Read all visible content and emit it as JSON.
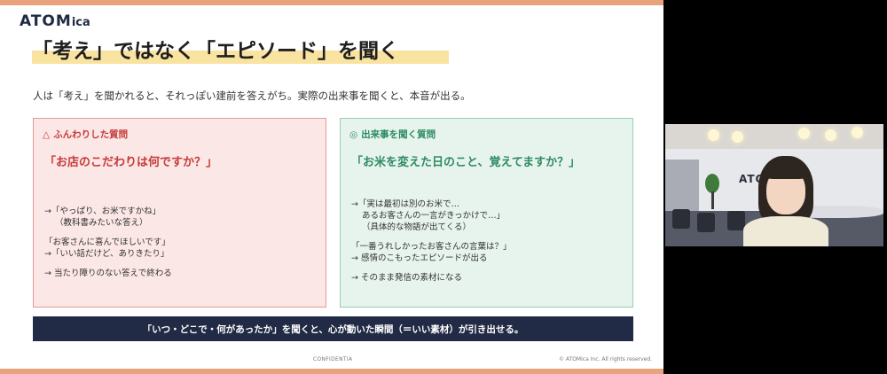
{
  "slide": {
    "logo_main": "ATOM",
    "logo_small": "ica",
    "title": "「考え」ではなく「エピソード」を聞く",
    "subtitle": "人は「考え」を聞かれると、それっぽい建前を答えがち。実際の出来事を聞くと、本音が出る。",
    "left_card": {
      "mark": "△",
      "label": "ふんわりした質問",
      "question": "「お店のこだわりは何ですか？」",
      "notes": [
        [
          "→「やっぱり、お米ですかね」",
          "（教科書みたいな答え）"
        ],
        [
          "「お客さんに喜んでほしいです」",
          "→「いい話だけど、ありきたり」"
        ],
        [
          "→ 当たり障りのない答えで終わる"
        ]
      ]
    },
    "right_card": {
      "mark": "◎",
      "label": "出来事を聞く質問",
      "question": "「お米を変えた日のこと、覚えてますか？」",
      "notes": [
        [
          "→「実は最初は別のお米で…",
          "あるお客さんの一言がきっかけで…」",
          "（具体的な物語が出てくる）"
        ],
        [
          "「一番うれしかったお客さんの言葉は？」",
          "→ 感情のこもったエピソードが出る"
        ],
        [
          "→ そのまま発信の素材になる"
        ]
      ]
    },
    "summary": "「いつ・どこで・何があったか」を聞くと、心が動いた瞬間（＝いい素材）が引き出せる。",
    "footer_left": "CONFIDENTIA",
    "footer_right": "© ATOMica Inc. All rights reserved."
  },
  "webcam": {
    "sign": "ATO"
  },
  "colors": {
    "accent_orange": "#e9a27c",
    "highlight_yellow": "#f9e3a0",
    "left_red": "#c63a3a",
    "right_green": "#2e8b62",
    "summary_navy": "#222b45"
  }
}
